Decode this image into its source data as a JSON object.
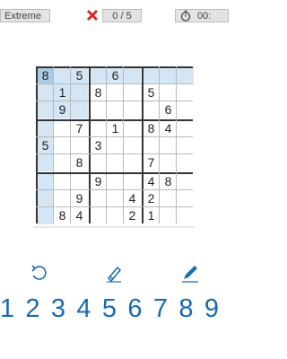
{
  "header": {
    "difficulty": "Extreme",
    "mistakes": "0 / 5",
    "timer": "00:"
  },
  "grid": [
    [
      "8",
      "",
      "5",
      "",
      "6",
      "",
      "",
      "",
      ""
    ],
    [
      "",
      "1",
      "",
      "8",
      "",
      "",
      "5",
      "",
      ""
    ],
    [
      "",
      "9",
      "",
      "",
      "",
      "",
      "",
      "6",
      ""
    ],
    [
      "",
      "",
      "7",
      "",
      "1",
      "",
      "8",
      "4",
      ""
    ],
    [
      "5",
      "",
      "",
      "3",
      "",
      "",
      "",
      "",
      ""
    ],
    [
      "",
      "",
      "8",
      "",
      "",
      "",
      "7",
      "",
      ""
    ],
    [
      "",
      "",
      "",
      "9",
      "",
      "",
      "4",
      "8",
      ""
    ],
    [
      "",
      "",
      "9",
      "",
      "",
      "4",
      "2",
      "",
      ""
    ],
    [
      "",
      "8",
      "4",
      "",
      "",
      "2",
      "1",
      "",
      ""
    ]
  ],
  "selected": {
    "row": 0,
    "col": 0
  },
  "tools": [
    "undo-icon",
    "erase-icon",
    "pencil-icon"
  ],
  "numpad": [
    "1",
    "2",
    "3",
    "4",
    "5",
    "6",
    "7",
    "8",
    "9"
  ],
  "colors": {
    "accent": "#1a6ab1",
    "highlight": "#d4e6f4",
    "selected": "#a9cbe6",
    "mistake": "#d9262b"
  }
}
